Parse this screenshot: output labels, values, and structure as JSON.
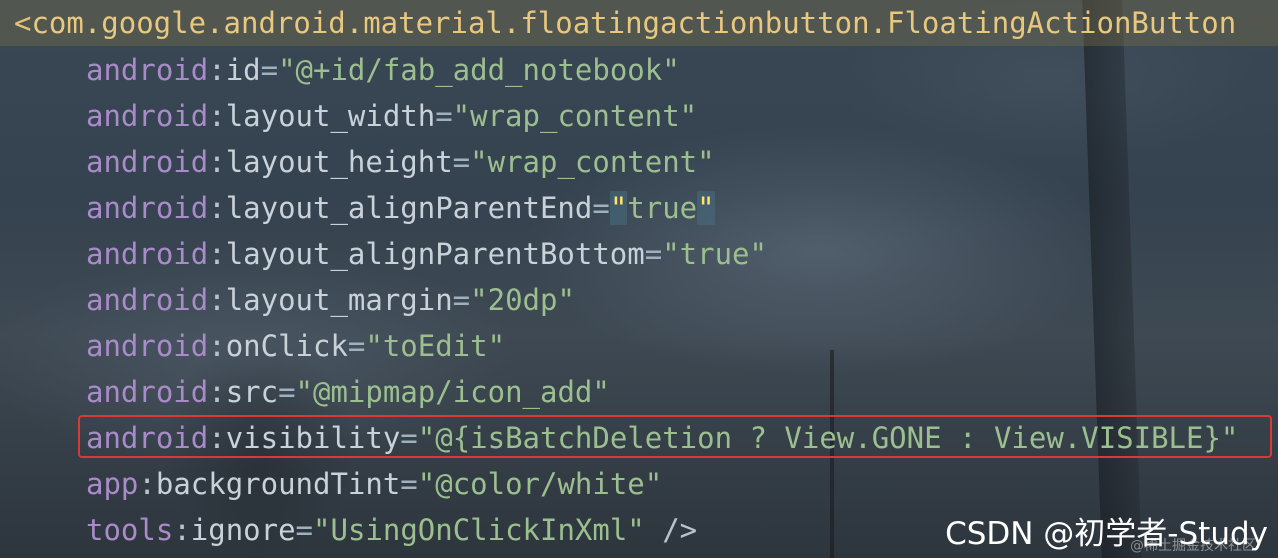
{
  "code": {
    "open_bracket": "<",
    "tag_name": "com.google.android.material.floatingactionbutton.FloatingActionButton",
    "lines": [
      {
        "ns": "android",
        "attr": "id",
        "value": "@+id/fab_add_notebook"
      },
      {
        "ns": "android",
        "attr": "layout_width",
        "value": "wrap_content"
      },
      {
        "ns": "android",
        "attr": "layout_height",
        "value": "wrap_content"
      },
      {
        "ns": "android",
        "attr": "layout_alignParentEnd",
        "value": "true"
      },
      {
        "ns": "android",
        "attr": "layout_alignParentBottom",
        "value": "true"
      },
      {
        "ns": "android",
        "attr": "layout_margin",
        "value": "20dp"
      },
      {
        "ns": "android",
        "attr": "onClick",
        "value": "toEdit"
      },
      {
        "ns": "android",
        "attr": "src",
        "value": "@mipmap/icon_add"
      },
      {
        "ns": "android",
        "attr": "visibility",
        "value": "@{isBatchDeletion ? View.GONE : View.VISIBLE}"
      },
      {
        "ns": "app",
        "attr": "backgroundTint",
        "value": "@color/white"
      },
      {
        "ns": "tools",
        "attr": "ignore",
        "value": "UsingOnClickInXml"
      }
    ],
    "close_tag": " />",
    "colon": ":",
    "equals": "=",
    "quote": "\""
  },
  "watermark": {
    "text": "CSDN @初学者-Study",
    "subtext": "@稀土掘金技术社区"
  },
  "colors": {
    "namespace": "#a98bc9",
    "tag": "#e8c87f",
    "string": "#9cbf90",
    "highlight_border": "#d93a34"
  }
}
